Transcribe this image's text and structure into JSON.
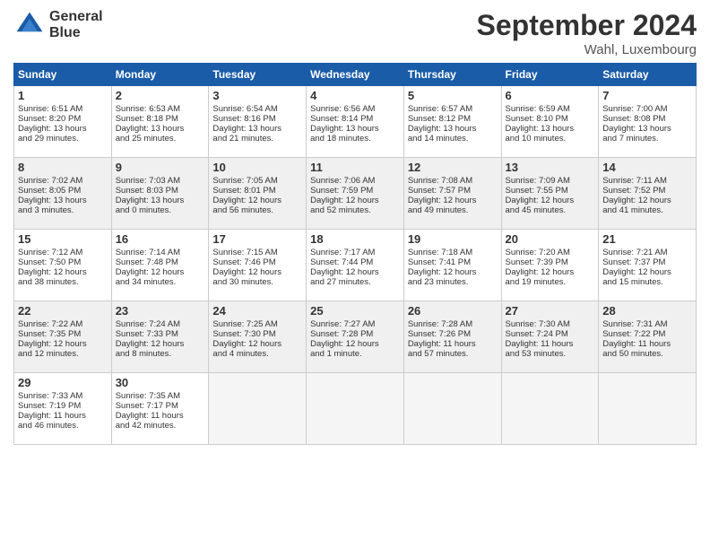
{
  "header": {
    "logo_line1": "General",
    "logo_line2": "Blue",
    "month": "September 2024",
    "location": "Wahl, Luxembourg"
  },
  "weekdays": [
    "Sunday",
    "Monday",
    "Tuesday",
    "Wednesday",
    "Thursday",
    "Friday",
    "Saturday"
  ],
  "weeks": [
    [
      {
        "day": "1",
        "lines": [
          "Sunrise: 6:51 AM",
          "Sunset: 8:20 PM",
          "Daylight: 13 hours",
          "and 29 minutes."
        ]
      },
      {
        "day": "2",
        "lines": [
          "Sunrise: 6:53 AM",
          "Sunset: 8:18 PM",
          "Daylight: 13 hours",
          "and 25 minutes."
        ]
      },
      {
        "day": "3",
        "lines": [
          "Sunrise: 6:54 AM",
          "Sunset: 8:16 PM",
          "Daylight: 13 hours",
          "and 21 minutes."
        ]
      },
      {
        "day": "4",
        "lines": [
          "Sunrise: 6:56 AM",
          "Sunset: 8:14 PM",
          "Daylight: 13 hours",
          "and 18 minutes."
        ]
      },
      {
        "day": "5",
        "lines": [
          "Sunrise: 6:57 AM",
          "Sunset: 8:12 PM",
          "Daylight: 13 hours",
          "and 14 minutes."
        ]
      },
      {
        "day": "6",
        "lines": [
          "Sunrise: 6:59 AM",
          "Sunset: 8:10 PM",
          "Daylight: 13 hours",
          "and 10 minutes."
        ]
      },
      {
        "day": "7",
        "lines": [
          "Sunrise: 7:00 AM",
          "Sunset: 8:08 PM",
          "Daylight: 13 hours",
          "and 7 minutes."
        ]
      }
    ],
    [
      {
        "day": "8",
        "lines": [
          "Sunrise: 7:02 AM",
          "Sunset: 8:05 PM",
          "Daylight: 13 hours",
          "and 3 minutes."
        ]
      },
      {
        "day": "9",
        "lines": [
          "Sunrise: 7:03 AM",
          "Sunset: 8:03 PM",
          "Daylight: 13 hours",
          "and 0 minutes."
        ]
      },
      {
        "day": "10",
        "lines": [
          "Sunrise: 7:05 AM",
          "Sunset: 8:01 PM",
          "Daylight: 12 hours",
          "and 56 minutes."
        ]
      },
      {
        "day": "11",
        "lines": [
          "Sunrise: 7:06 AM",
          "Sunset: 7:59 PM",
          "Daylight: 12 hours",
          "and 52 minutes."
        ]
      },
      {
        "day": "12",
        "lines": [
          "Sunrise: 7:08 AM",
          "Sunset: 7:57 PM",
          "Daylight: 12 hours",
          "and 49 minutes."
        ]
      },
      {
        "day": "13",
        "lines": [
          "Sunrise: 7:09 AM",
          "Sunset: 7:55 PM",
          "Daylight: 12 hours",
          "and 45 minutes."
        ]
      },
      {
        "day": "14",
        "lines": [
          "Sunrise: 7:11 AM",
          "Sunset: 7:52 PM",
          "Daylight: 12 hours",
          "and 41 minutes."
        ]
      }
    ],
    [
      {
        "day": "15",
        "lines": [
          "Sunrise: 7:12 AM",
          "Sunset: 7:50 PM",
          "Daylight: 12 hours",
          "and 38 minutes."
        ]
      },
      {
        "day": "16",
        "lines": [
          "Sunrise: 7:14 AM",
          "Sunset: 7:48 PM",
          "Daylight: 12 hours",
          "and 34 minutes."
        ]
      },
      {
        "day": "17",
        "lines": [
          "Sunrise: 7:15 AM",
          "Sunset: 7:46 PM",
          "Daylight: 12 hours",
          "and 30 minutes."
        ]
      },
      {
        "day": "18",
        "lines": [
          "Sunrise: 7:17 AM",
          "Sunset: 7:44 PM",
          "Daylight: 12 hours",
          "and 27 minutes."
        ]
      },
      {
        "day": "19",
        "lines": [
          "Sunrise: 7:18 AM",
          "Sunset: 7:41 PM",
          "Daylight: 12 hours",
          "and 23 minutes."
        ]
      },
      {
        "day": "20",
        "lines": [
          "Sunrise: 7:20 AM",
          "Sunset: 7:39 PM",
          "Daylight: 12 hours",
          "and 19 minutes."
        ]
      },
      {
        "day": "21",
        "lines": [
          "Sunrise: 7:21 AM",
          "Sunset: 7:37 PM",
          "Daylight: 12 hours",
          "and 15 minutes."
        ]
      }
    ],
    [
      {
        "day": "22",
        "lines": [
          "Sunrise: 7:22 AM",
          "Sunset: 7:35 PM",
          "Daylight: 12 hours",
          "and 12 minutes."
        ]
      },
      {
        "day": "23",
        "lines": [
          "Sunrise: 7:24 AM",
          "Sunset: 7:33 PM",
          "Daylight: 12 hours",
          "and 8 minutes."
        ]
      },
      {
        "day": "24",
        "lines": [
          "Sunrise: 7:25 AM",
          "Sunset: 7:30 PM",
          "Daylight: 12 hours",
          "and 4 minutes."
        ]
      },
      {
        "day": "25",
        "lines": [
          "Sunrise: 7:27 AM",
          "Sunset: 7:28 PM",
          "Daylight: 12 hours",
          "and 1 minute."
        ]
      },
      {
        "day": "26",
        "lines": [
          "Sunrise: 7:28 AM",
          "Sunset: 7:26 PM",
          "Daylight: 11 hours",
          "and 57 minutes."
        ]
      },
      {
        "day": "27",
        "lines": [
          "Sunrise: 7:30 AM",
          "Sunset: 7:24 PM",
          "Daylight: 11 hours",
          "and 53 minutes."
        ]
      },
      {
        "day": "28",
        "lines": [
          "Sunrise: 7:31 AM",
          "Sunset: 7:22 PM",
          "Daylight: 11 hours",
          "and 50 minutes."
        ]
      }
    ],
    [
      {
        "day": "29",
        "lines": [
          "Sunrise: 7:33 AM",
          "Sunset: 7:19 PM",
          "Daylight: 11 hours",
          "and 46 minutes."
        ]
      },
      {
        "day": "30",
        "lines": [
          "Sunrise: 7:35 AM",
          "Sunset: 7:17 PM",
          "Daylight: 11 hours",
          "and 42 minutes."
        ]
      },
      {
        "day": "",
        "lines": []
      },
      {
        "day": "",
        "lines": []
      },
      {
        "day": "",
        "lines": []
      },
      {
        "day": "",
        "lines": []
      },
      {
        "day": "",
        "lines": []
      }
    ]
  ]
}
